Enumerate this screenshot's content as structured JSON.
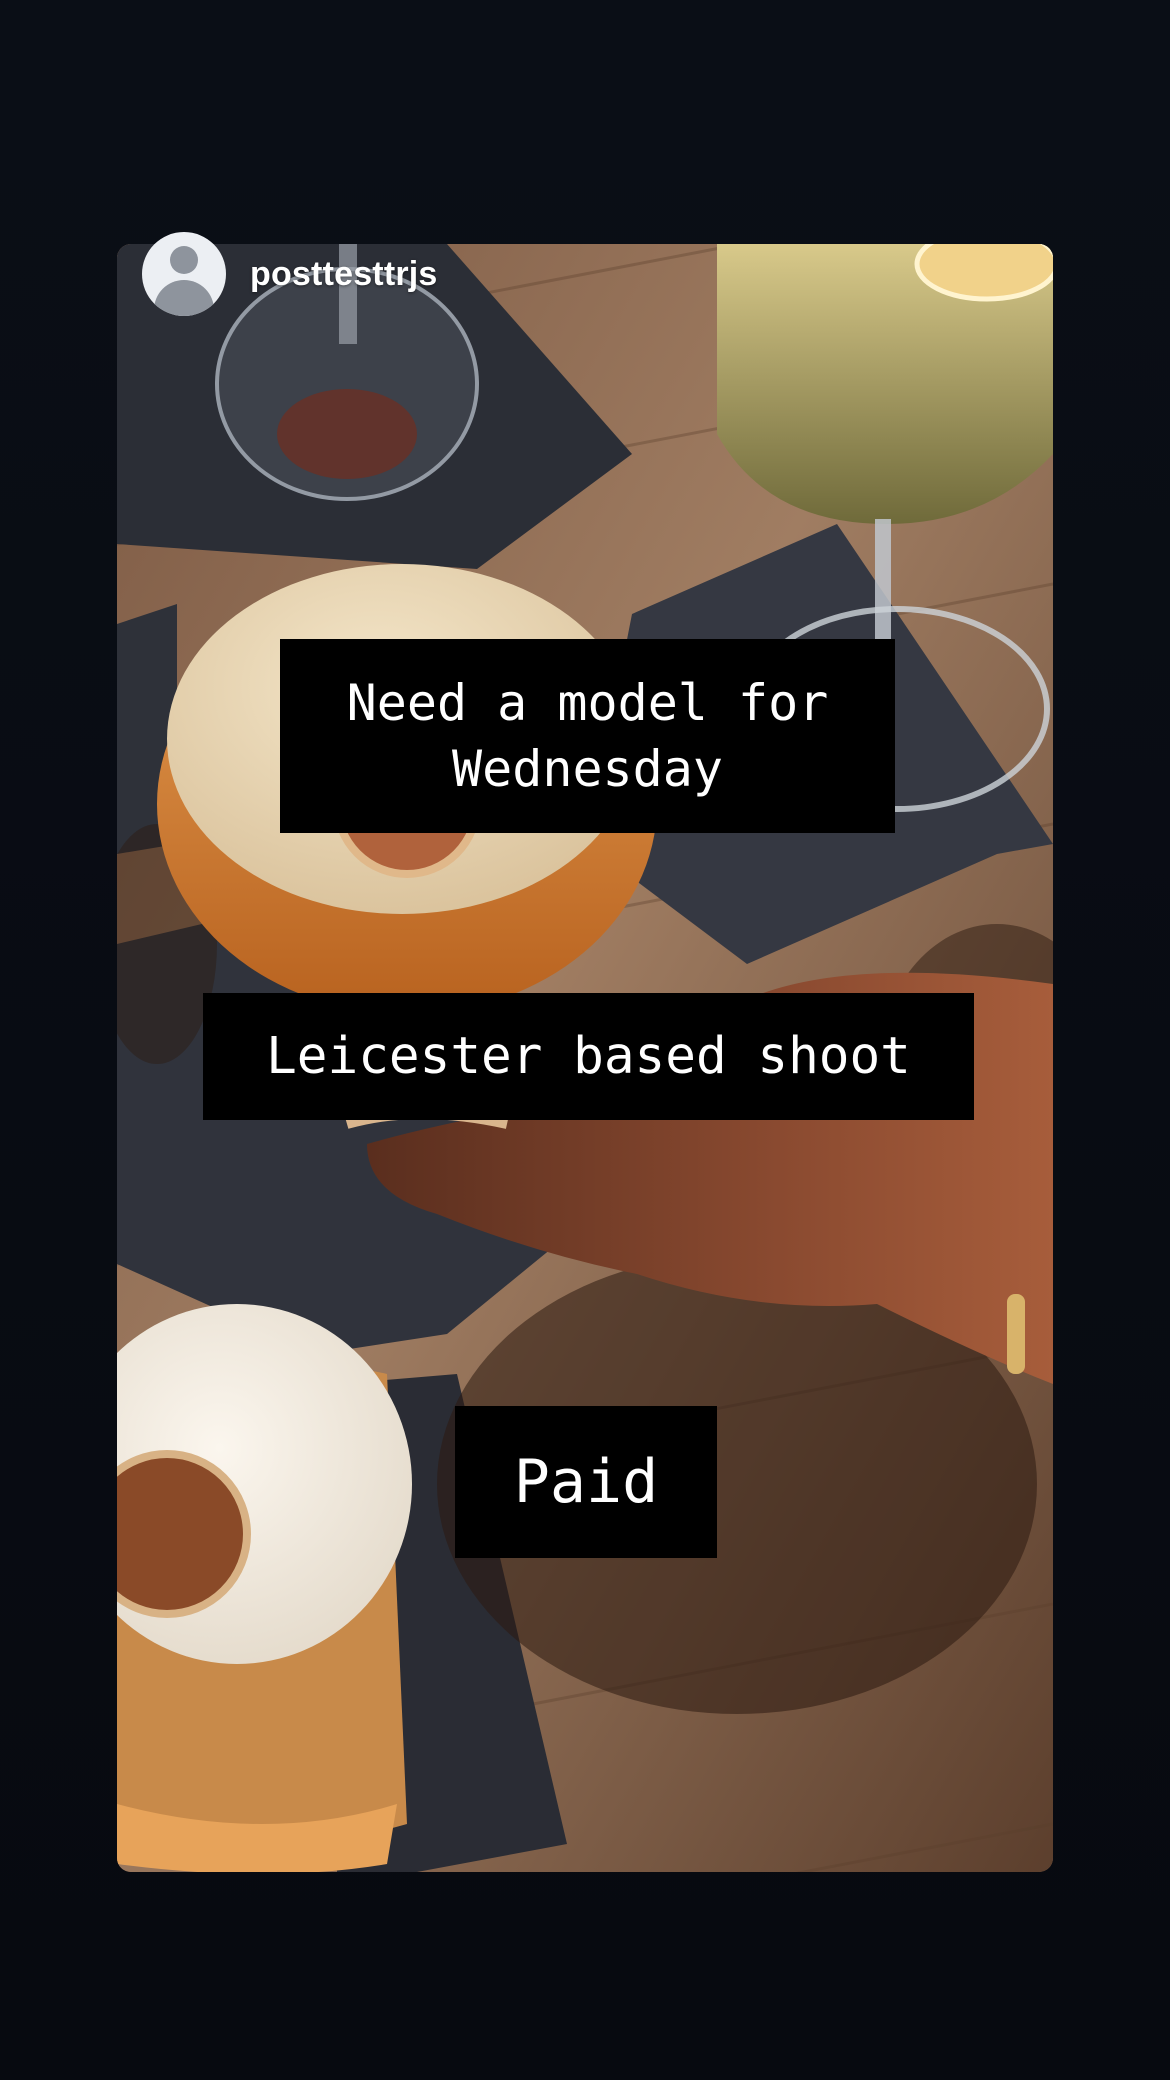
{
  "story": {
    "username": "posttesttrjs",
    "captions": [
      "Need a model for Wednesday",
      "Leicester based shoot",
      "Paid"
    ]
  },
  "colors": {
    "background": "#080c13",
    "caption_background": "#000000",
    "caption_text": "#ffffff"
  },
  "icons": {
    "avatar": "default-user-avatar-icon"
  }
}
